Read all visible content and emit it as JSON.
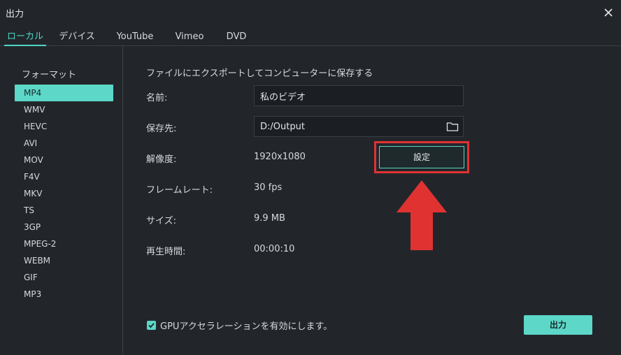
{
  "window": {
    "title": "出力",
    "close_icon": "close-icon"
  },
  "tabs": [
    {
      "label": "ローカル",
      "active": true
    },
    {
      "label": "デバイス"
    },
    {
      "label": "YouTube"
    },
    {
      "label": "Vimeo"
    },
    {
      "label": "DVD"
    }
  ],
  "sidebar": {
    "label": "フォーマット",
    "formats": [
      "MP4",
      "WMV",
      "HEVC",
      "AVI",
      "MOV",
      "F4V",
      "MKV",
      "TS",
      "3GP",
      "MPEG-2",
      "WEBM",
      "GIF",
      "MP3"
    ],
    "selected": "MP4"
  },
  "main": {
    "heading": "ファイルにエクスポートしてコンピューターに保存する",
    "name_label": "名前:",
    "name_value": "私のビデオ",
    "save_label": "保存先:",
    "save_value": "D:/Output",
    "resolution_label": "解像度:",
    "resolution_value": "1920x1080",
    "settings_button": "設定",
    "framerate_label": "フレームレート:",
    "framerate_value": "30 fps",
    "size_label": "サイズ:",
    "size_value": "9.9 MB",
    "duration_label": "再生時間:",
    "duration_value": "00:00:10",
    "gpu_label": "GPUアクセラレーションを有効にします。",
    "gpu_checked": true,
    "export_button": "出力"
  },
  "colors": {
    "accent": "#5cd7c8",
    "background": "#22262b",
    "highlight": "#e13232"
  }
}
